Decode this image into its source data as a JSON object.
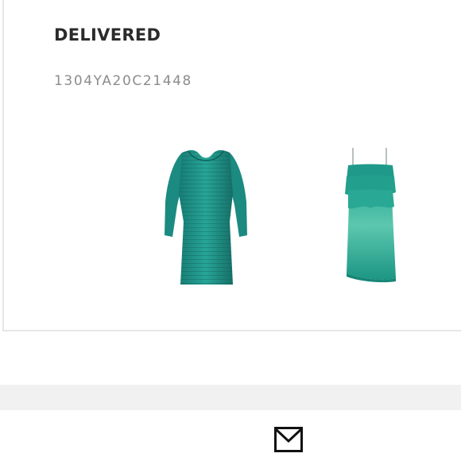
{
  "order": {
    "status": "DELIVERED",
    "code": "1304YA20C21448",
    "items": [
      {
        "image": "teal long-sleeve dress"
      },
      {
        "image": "teal ruffled slip dress"
      }
    ]
  },
  "footer": {
    "icon": "envelope-icon"
  },
  "colors": {
    "text_dark": "#2b2b2b",
    "text_muted": "#8c8c8c",
    "border": "#e6e6e6",
    "band": "#f1f1f1",
    "dress_teal": "#1f9a8f"
  }
}
